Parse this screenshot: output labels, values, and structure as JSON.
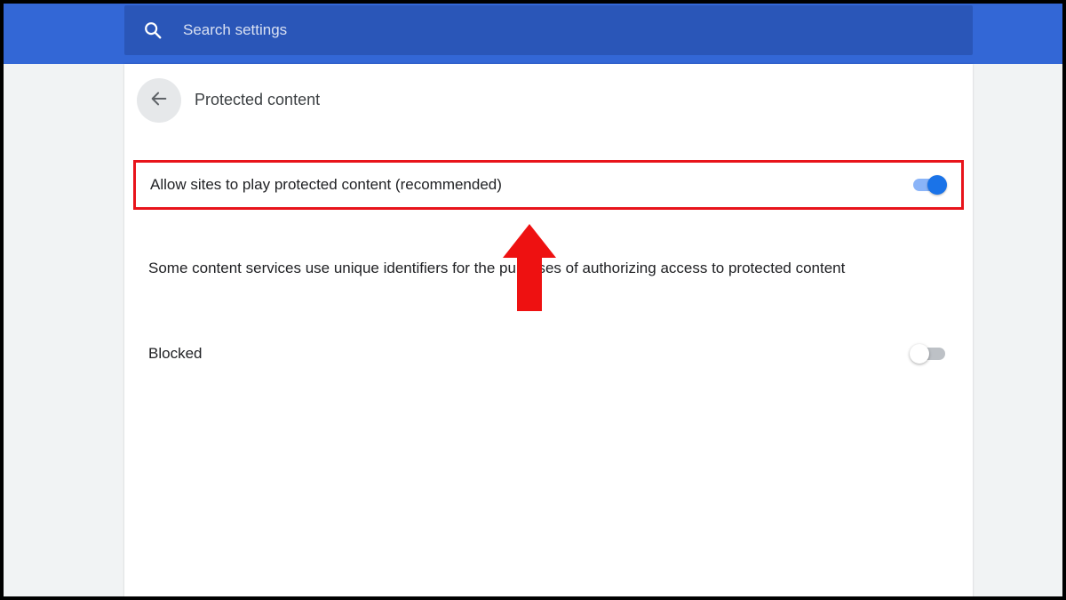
{
  "search": {
    "placeholder": "Search settings",
    "icon": "search-icon"
  },
  "header": {
    "title": "Protected content",
    "back_icon": "arrow-back-icon"
  },
  "settings": {
    "allow": {
      "label": "Allow sites to play protected content (recommended)",
      "enabled": true
    },
    "description": "Some content services use unique identifiers for the purposes of authorizing access to protected content",
    "blocked": {
      "label": "Blocked",
      "enabled": false
    }
  },
  "colors": {
    "topbar": "#3367d6",
    "search_box": "#2a56b8",
    "toggle_on": "#1a73e8",
    "highlight": "#e8141b"
  }
}
